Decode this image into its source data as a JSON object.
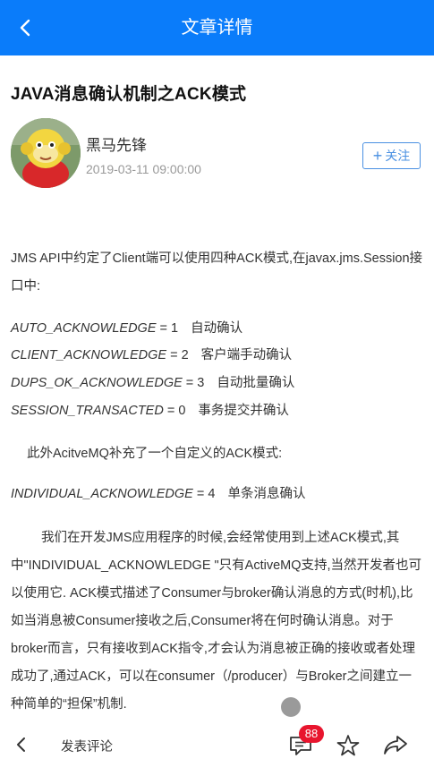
{
  "header": {
    "title": "文章详情",
    "back_icon": "chevron-left-icon"
  },
  "article": {
    "title": "JAVA消息确认机制之ACK模式",
    "author": "黑马先锋",
    "time": "2019-03-11 09:00:00",
    "follow_label": "关注",
    "intro": "JMS API中约定了Client端可以使用四种ACK模式,在javax.jms.Session接口中:",
    "modes": [
      {
        "key": "AUTO_ACKNOWLEDGE",
        "value": " = 1",
        "desc": "自动确认"
      },
      {
        "key": "CLIENT_ACKNOWLEDGE",
        "value": " = 2",
        "desc": "客户端手动确认"
      },
      {
        "key": "DUPS_OK_ACKNOWLEDGE",
        "value": " = 3",
        "desc": "自动批量确认"
      },
      {
        "key": "SESSION_TRANSACTED",
        "value": " = 0",
        "desc": "事务提交并确认"
      }
    ],
    "extra_intro": "此外AcitveMQ补充了一个自定义的ACK模式:",
    "extra_mode": {
      "key": "INDIVIDUAL_ACKNOWLEDGE",
      "value": " = 4",
      "desc": "单条消息确认"
    },
    "body": "我们在开发JMS应用程序的时候,会经常使用到上述ACK模式,其中\"INDIVIDUAL_ACKNOWLEDGE \"只有ActiveMQ支持,当然开发者也可以使用它. ACK模式描述了Consumer与broker确认消息的方式(时机),比如当消息被Consumer接收之后,Consumer将在何时确认消息。对于broker而言，只有接收到ACK指令,才会认为消息被正确的接收或者处理成功了,通过ACK，可以在consumer（/producer）与Broker之间建立一种简单的“担保”机制."
  },
  "bottom_bar": {
    "comment_placeholder": "发表评论",
    "comment_count": "88",
    "icons": [
      "chevron-left-icon",
      "comment-icon",
      "star-icon",
      "share-icon"
    ]
  },
  "colors": {
    "header": "#0a7cfa",
    "follow": "#4a90e2",
    "badge": "#e8152e"
  }
}
